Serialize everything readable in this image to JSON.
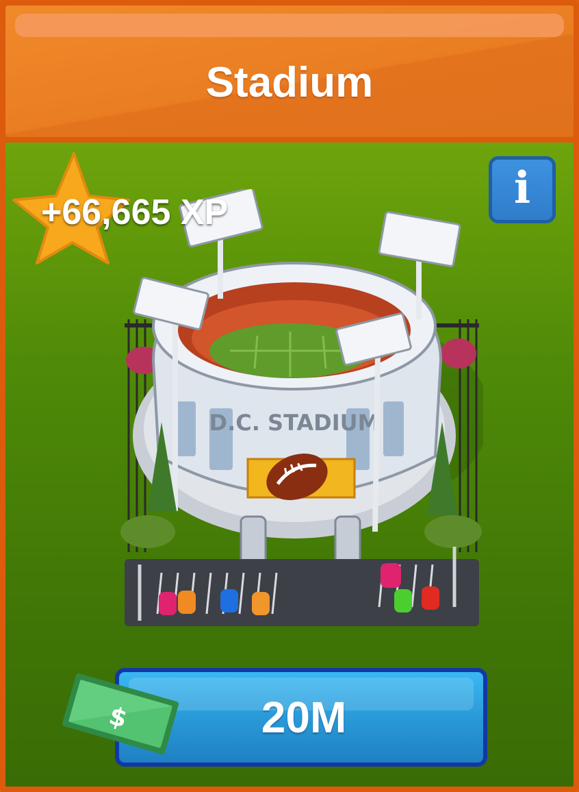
{
  "header": {
    "title": "Stadium"
  },
  "reward": {
    "xp_label": "+66,665 XP",
    "icon": "star-icon"
  },
  "info_button": {
    "glyph": "i",
    "icon": "info-icon"
  },
  "building": {
    "image": "stadium-illustration",
    "sign_text": "D.C. STADIUM"
  },
  "purchase": {
    "price": "20M",
    "currency_icon": "cash-icon",
    "currency_symbol": "$"
  },
  "colors": {
    "frame": "#dc5b0c",
    "header": "#ea7d22",
    "panel": "#4f8a08",
    "button": "#2a9ad8",
    "button_border": "#1238a8",
    "star": "#f7a81c",
    "cash": "#3ea95a"
  }
}
